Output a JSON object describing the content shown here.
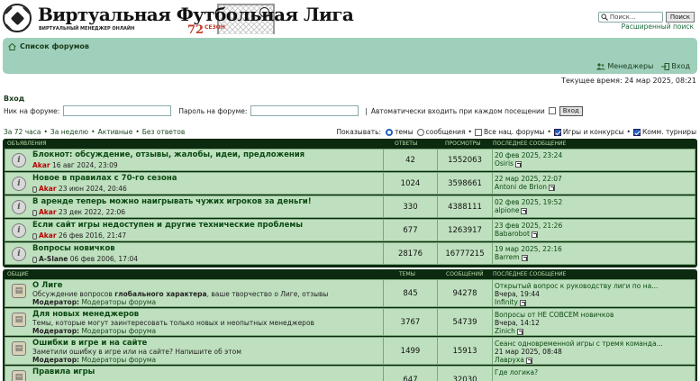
{
  "header": {
    "logo_title": "Виртуальная Футбольная Лига",
    "logo_subtitle": "ВИРТУАЛЬНЫЙ МЕНЕДЖЕР ОНЛАЙН",
    "logo_number": "72",
    "logo_season": "СЕЗОН",
    "search_placeholder": "Поиск...",
    "search_button": "Поиск",
    "advanced_search": "Расширенный поиск"
  },
  "navbar": {
    "breadcrumb": "Список форумов",
    "managers": "Менеджеры",
    "login": "Вход"
  },
  "time": "Текущее время: 24 мар 2025, 08:21",
  "login": {
    "title": "Вход",
    "nick_label": "Ник на форуме:",
    "pass_label": "Пароль на форуме:",
    "sep": "|",
    "auto_label": "Автоматически входить при каждом посещении",
    "button": "Вход"
  },
  "quick": {
    "h72": "За 72 часа",
    "week": "За неделю",
    "active": "Активные",
    "noreply": "Без ответов",
    "dot": "•"
  },
  "filters": {
    "show": "Показывать:",
    "topics": "темы",
    "messages": "сообщения",
    "all_nat": "Все нац. форумы",
    "games": "Игры и конкурсы",
    "comm": "Комм. турниры",
    "dot": "•"
  },
  "announcements": {
    "header": "Объявления",
    "col1": "Ответы",
    "col2": "Просмотры",
    "col3": "Последнее сообщение",
    "rows": [
      {
        "title": "Блокнот: обсуждение, отзывы, жалобы, идеи, предложения",
        "author": "Akar",
        "date": "16 авг 2024, 23:09",
        "replies": "42",
        "views": "1552063",
        "last_date": "20 фев 2025, 23:24",
        "last_user": "Osiris"
      },
      {
        "title": "Новое в правилах с 70-го сезона",
        "author": "Akar",
        "date": "23 июн 2024, 20:46",
        "replies": "1024",
        "views": "3598661",
        "last_date": "22 мар 2025, 22:07",
        "last_user": "Antoni de Brion"
      },
      {
        "title": "В аренде теперь можно наигрывать чужих игроков за деньги!",
        "author": "Akar",
        "date": "23 дек 2022, 22:06",
        "replies": "330",
        "views": "4388111",
        "last_date": "02 фев 2025, 19:52",
        "last_user": "alpione"
      },
      {
        "title": "Если сайт игры недоступен и другие технические проблемы",
        "author": "Akar",
        "date": "26 фев 2016, 21:47",
        "replies": "677",
        "views": "1263917",
        "last_date": "23 фев 2025, 21:26",
        "last_user": "Babarobot"
      },
      {
        "title": "Вопросы новичков",
        "author": "A-Slane",
        "date": "06 фев 2006, 17:04",
        "replies": "28176",
        "views": "16777215",
        "last_date": "19 мар 2025, 22:16",
        "last_user": "Barrem"
      }
    ]
  },
  "general": {
    "header": "Общие",
    "col1": "Темы",
    "col2": "Сообщений",
    "col3": "Последнее сообщение",
    "moderator_label": "Модератор:",
    "moderators": "Модераторы форума",
    "rows": [
      {
        "title": "О Лиге",
        "desc_a": "Обсуждение вопросов ",
        "desc_b": "глобального характера",
        "desc_c": ", ваше творчество о Лиге, отзывы",
        "topics": "845",
        "posts": "94278",
        "last_title": "Открытый вопрос к руководству лиги по на...",
        "last_date": "Вчера, 19:44",
        "last_user": "Infinity"
      },
      {
        "title": "Для новых менеджеров",
        "desc_a": "Темы, которые могут заинтересовать только новых и неопытных менеджеров",
        "desc_b": "",
        "desc_c": "",
        "topics": "3767",
        "posts": "54739",
        "last_title": "Вопросы от НЕ СОВСЕМ новичков",
        "last_date": "Вчера, 14:12",
        "last_user": "Zinich"
      },
      {
        "title": "Ошибки в игре и на сайте",
        "desc_a": "Заметили ошибку в игре или на сайте? Напишите об этом",
        "desc_b": "",
        "desc_c": "",
        "topics": "1499",
        "posts": "15913",
        "last_title": "Сеанс одновременной игры с тремя команда...",
        "last_date": "21 мар 2025, 08:48",
        "last_user": "Лавруха"
      },
      {
        "title": "Правила игры",
        "desc_a": "",
        "desc_b": "",
        "desc_c": "",
        "topics": "647",
        "posts": "32030",
        "last_title": "Где логика?",
        "last_date": "",
        "last_user": ""
      }
    ]
  }
}
